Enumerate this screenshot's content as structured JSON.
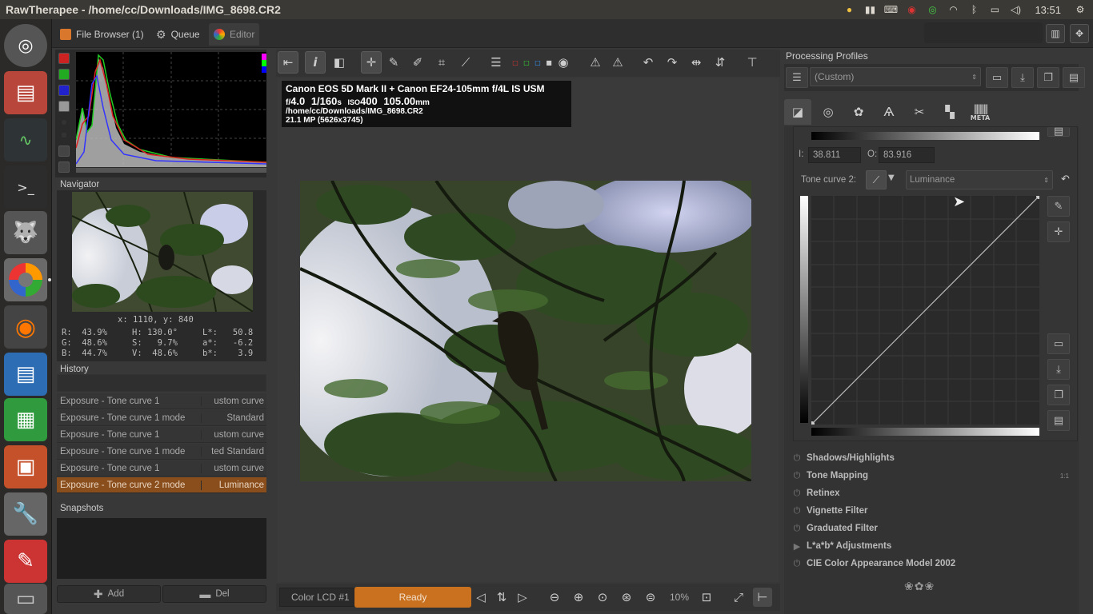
{
  "window": {
    "title": "RawTherapee  - /home/cc/Downloads/IMG_8698.CR2"
  },
  "tray": {
    "clock": "13:51"
  },
  "tabs": [
    {
      "label": "File Browser (1)"
    },
    {
      "label": "Queue"
    },
    {
      "label": "Editor"
    }
  ],
  "navigator": {
    "title": "Navigator",
    "coords": "x: 1110, y: 840",
    "readout": {
      "r": "R:  43.9%",
      "g": "G:  48.6%",
      "b": "B:  44.7%",
      "h": "H: 130.0°",
      "s": "S:   9.7%",
      "v": "V:  48.6%",
      "l": "L*:   50.8",
      "a": "a*:   -6.2",
      "bstar": "b*:    3.9"
    }
  },
  "history": {
    "title": "History",
    "rows": [
      {
        "action": "Exposure - Tone curve 1",
        "value": "ustom curve"
      },
      {
        "action": "Exposure - Tone curve 1 mode",
        "value": "Standard"
      },
      {
        "action": "Exposure - Tone curve 1",
        "value": "ustom curve"
      },
      {
        "action": "Exposure - Tone curve 1 mode",
        "value": "ted Standard"
      },
      {
        "action": "Exposure - Tone curve 1",
        "value": "ustom curve"
      },
      {
        "action": "Exposure - Tone curve 2 mode",
        "value": "Luminance"
      }
    ]
  },
  "snapshots": {
    "title": "Snapshots",
    "add_label": "Add",
    "del_label": "Del"
  },
  "exif": {
    "camera": "Canon EOS 5D Mark II + Canon EF24-105mm f/4L IS USM",
    "f_prefix": "f/",
    "aperture": "4.0",
    "shutter": "1/160",
    "shutter_unit": "s",
    "iso_prefix": "ISO",
    "iso": "400",
    "focal": "105.00",
    "focal_unit": "mm",
    "path": "/home/cc/Downloads/IMG_8698.CR2",
    "resolution": "21.1 MP (5626x3745)"
  },
  "bottombar": {
    "output_profile": "Color LCD #1",
    "status": "Ready",
    "zoom": "10%"
  },
  "processing_profiles": {
    "title": "Processing Profiles",
    "selected": "(Custom)"
  },
  "tone_curve": {
    "i_label": "I:",
    "i_value": "38.811",
    "o_label": "O:",
    "o_value": "83.916",
    "curve2_label": "Tone curve 2:",
    "mode": "Luminance"
  },
  "tools": [
    {
      "label": "Shadows/Highlights"
    },
    {
      "label": "Tone Mapping",
      "badge": "1:1"
    },
    {
      "label": "Retinex"
    },
    {
      "label": "Vignette Filter"
    },
    {
      "label": "Graduated Filter"
    },
    {
      "label": "L*a*b* Adjustments"
    },
    {
      "label": "CIE Color Appearance Model 2002"
    }
  ],
  "meta_tab_label": "META",
  "colors": {
    "accent": "#c9711f",
    "history_selected": "#8a4e1c",
    "topbar": "#3a3935"
  }
}
